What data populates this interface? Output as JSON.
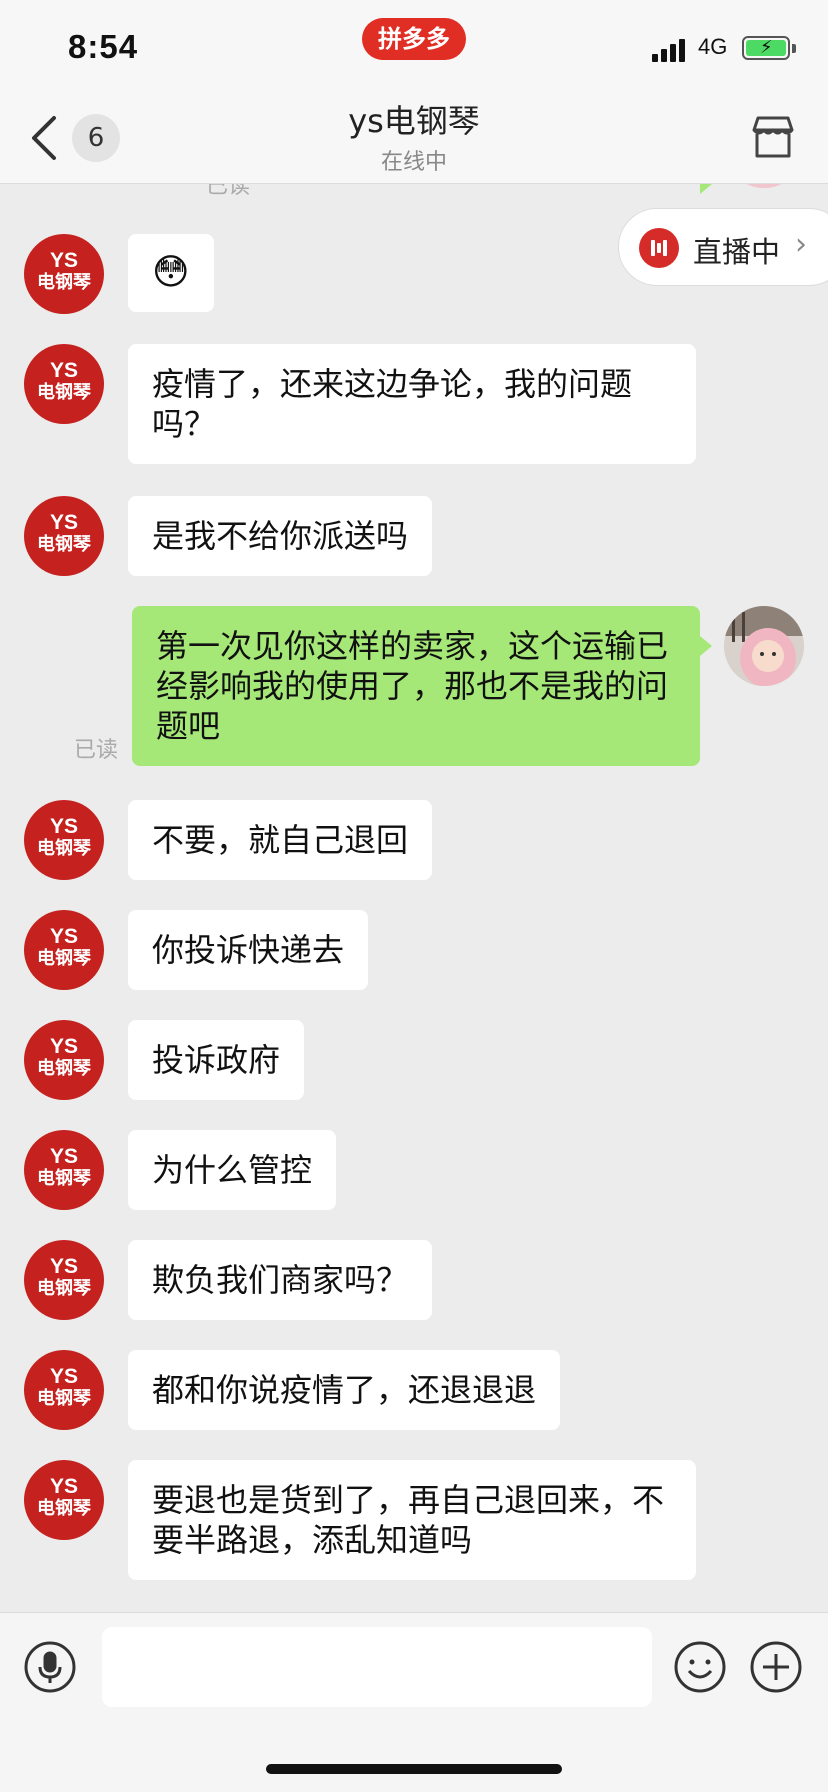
{
  "status_bar": {
    "time": "8:54",
    "app_badge": "拼多多",
    "network": "4G",
    "signal_icon": "cellular-signal-icon",
    "battery_icon": "battery-charging-icon",
    "battery_color": "#4cd964"
  },
  "header": {
    "unread_count": "6",
    "title": "ys电钢琴",
    "subtitle": "在线中",
    "back_icon": "chevron-left-icon",
    "store_icon": "storefront-icon"
  },
  "live_banner": {
    "label": "直播中",
    "icon": "live-bars-icon",
    "accent": "#d52b29"
  },
  "seller_avatar": {
    "line1": "YS",
    "line2": "电钢琴",
    "color": "#c4211f"
  },
  "read_label": "已读",
  "messages": [
    {
      "from": "seller",
      "text": "😳"
    },
    {
      "from": "seller",
      "text": "疫情了，还来这边争论，我的问题吗？"
    },
    {
      "from": "seller",
      "text": "是我不给你派送吗"
    },
    {
      "from": "user",
      "text": "第一次见你这样的卖家，这个运输已经影响我的使用了，那也不是我的问题吧",
      "status": "已读"
    },
    {
      "from": "seller",
      "text": "不要，就自己退回"
    },
    {
      "from": "seller",
      "text": "你投诉快递去"
    },
    {
      "from": "seller",
      "text": "投诉政府"
    },
    {
      "from": "seller",
      "text": "为什么管控"
    },
    {
      "from": "seller",
      "text": "欺负我们商家吗？"
    },
    {
      "from": "seller",
      "text": "都和你说疫情了，还退退退"
    },
    {
      "from": "seller",
      "text": "要退也是货到了，再自己退回来，不要半路退，添乱知道吗"
    }
  ],
  "input_bar": {
    "placeholder": "",
    "voice_icon": "microphone-icon",
    "emoji_icon": "smiley-icon",
    "plus_icon": "plus-circle-icon"
  },
  "colors": {
    "outgoing_bubble": "#a5e878",
    "incoming_bubble": "#ffffff",
    "background": "#ececec"
  }
}
